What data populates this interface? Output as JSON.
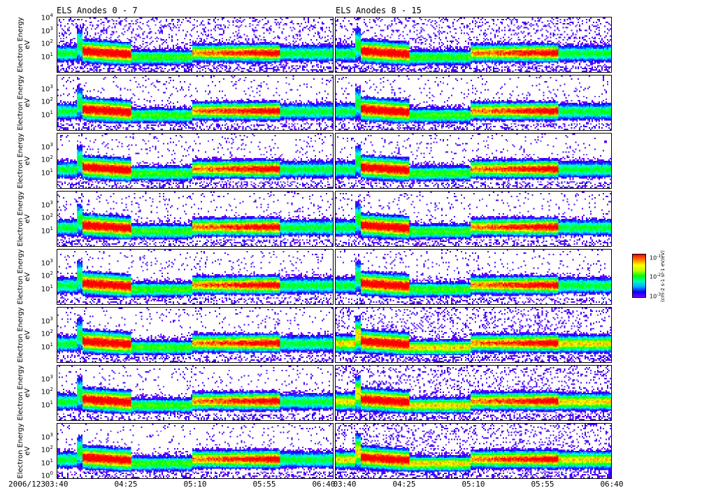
{
  "chart_data": {
    "type": "heatmap",
    "titles": [
      "ELS Anodes 0 - 7",
      "ELS Anodes 8 - 15"
    ],
    "ylabel": "Electron Energy",
    "yunit": "eV",
    "yscale": "log",
    "ylim": [
      0.5,
      10000
    ],
    "panel_count_per_column": 8,
    "top_panel_yticks": [
      {
        "base": "10",
        "exp": "4"
      },
      {
        "base": "10",
        "exp": "3"
      },
      {
        "base": "10",
        "exp": "2"
      },
      {
        "base": "10",
        "exp": "1"
      }
    ],
    "mid_panel_yticks": [
      {
        "base": "10",
        "exp": "3"
      },
      {
        "base": "10",
        "exp": "2"
      },
      {
        "base": "10",
        "exp": "1"
      }
    ],
    "bottom_panel_yticks": [
      {
        "base": "10",
        "exp": "3"
      },
      {
        "base": "10",
        "exp": "2"
      },
      {
        "base": "10",
        "exp": "1"
      },
      {
        "base": "10",
        "exp": "0"
      }
    ],
    "date_label": "2006/123",
    "xticks_left": [
      "03:40",
      "04:25",
      "05:10",
      "05:55",
      "06:40"
    ],
    "xticks_right": [
      "03:40",
      "04:25",
      "05:10",
      "05:55",
      "06:40"
    ],
    "xlim_minutes": [
      0,
      180
    ],
    "events_minutes": {
      "plasma_spike": 14,
      "dense_interval_1": [
        16,
        48
      ],
      "gap_interval": [
        48,
        88
      ],
      "dense_interval_2": [
        88,
        145
      ]
    },
    "colorbar": {
      "ticks": [
        {
          "base": "10",
          "exp": "-1"
        },
        {
          "base": "10",
          "exp": "-2"
        },
        {
          "base": "10",
          "exp": "-3"
        }
      ],
      "label": "(cm-2 s-1 sr-1 eV/eV)",
      "colormap": "rainbow"
    }
  }
}
